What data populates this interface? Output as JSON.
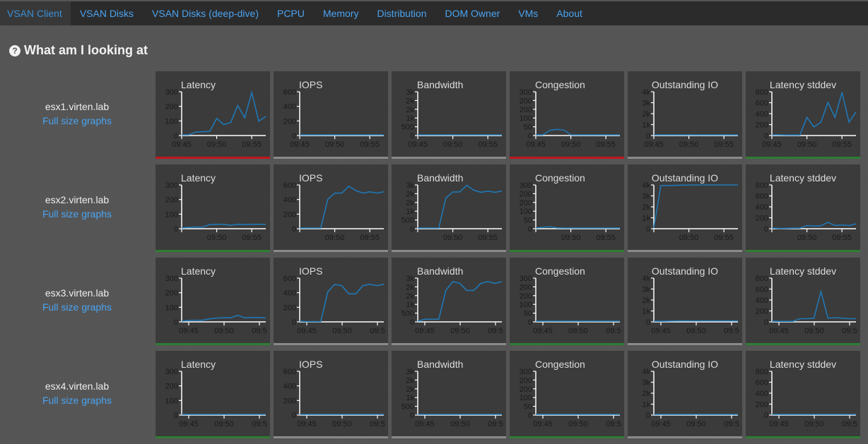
{
  "nav": {
    "items": [
      {
        "label": "VSAN Client",
        "active": true
      },
      {
        "label": "VSAN Disks"
      },
      {
        "label": "VSAN Disks (deep-dive)"
      },
      {
        "label": "PCPU"
      },
      {
        "label": "Memory"
      },
      {
        "label": "Distribution"
      },
      {
        "label": "DOM Owner"
      },
      {
        "label": "VMs"
      },
      {
        "label": "About"
      }
    ]
  },
  "help": {
    "label": "What am I looking at",
    "icon": "question-circle-icon"
  },
  "full_size_label": "Full size graphs",
  "colors": {
    "line": "#1f77b4",
    "red": "#c0161b",
    "gray": "#8a8a8a",
    "green": "#2e7d32"
  },
  "chart_data": [
    {
      "host": "esx1.virten.lab",
      "charts": [
        {
          "type": "line",
          "title": "Latency",
          "yticks": [
            "0",
            "100",
            "200",
            "300"
          ],
          "ylim": [
            0,
            320
          ],
          "xticks": [
            "09:45",
            "09:50",
            "09:55"
          ],
          "x": [
            0,
            1,
            2,
            3,
            4,
            5,
            6,
            7,
            8,
            9,
            10,
            11,
            12
          ],
          "values": [
            0,
            5,
            25,
            28,
            30,
            125,
            80,
            95,
            220,
            130,
            315,
            105,
            140
          ],
          "status": "red"
        },
        {
          "type": "line",
          "title": "IOPS",
          "yticks": [
            "0",
            "200",
            "400",
            "600"
          ],
          "ylim": [
            0,
            640
          ],
          "xticks": [
            "09:45",
            "09:50",
            "09:55"
          ],
          "x": [
            0,
            12
          ],
          "values": [
            0,
            0
          ],
          "status": "gray"
        },
        {
          "type": "line",
          "title": "Bandwidth",
          "yticks": [
            "0",
            "500",
            "1k",
            "2k",
            "2k",
            "3k"
          ],
          "ylim": [
            0,
            2500
          ],
          "xticks": [
            "09:45",
            "09:50",
            "09:55"
          ],
          "x": [
            0,
            12
          ],
          "values": [
            0,
            0
          ],
          "status": "gray"
        },
        {
          "type": "line",
          "title": "Congestion",
          "yticks": [
            "0",
            "50",
            "100",
            "200",
            "200",
            "300"
          ],
          "ylim": [
            0,
            250
          ],
          "xticks": [
            "09:45",
            "09:50",
            "09:55"
          ],
          "x": [
            0,
            1,
            2,
            3,
            4,
            5,
            6,
            12
          ],
          "values": [
            0,
            0,
            30,
            35,
            32,
            0,
            0,
            0
          ],
          "status": "red"
        },
        {
          "type": "line",
          "title": "Outstanding IO",
          "yticks": [
            "0",
            "1k",
            "2k",
            "3k",
            "4k"
          ],
          "ylim": [
            0,
            4000
          ],
          "xticks": [
            "09:45",
            "09:50",
            "09:55"
          ],
          "x": [
            0,
            12
          ],
          "values": [
            0,
            0
          ],
          "status": "gray"
        },
        {
          "type": "line",
          "title": "Latency stddev",
          "yticks": [
            "0",
            "200",
            "400",
            "600",
            "800"
          ],
          "ylim": [
            0,
            820
          ],
          "xticks": [
            "09:45",
            "09:50",
            "09:55"
          ],
          "x": [
            0,
            1,
            2,
            3,
            4,
            5,
            6,
            7,
            8,
            9,
            10,
            11,
            12
          ],
          "values": [
            0,
            0,
            10,
            10,
            10,
            340,
            160,
            250,
            620,
            340,
            810,
            250,
            440
          ],
          "status": "green"
        }
      ]
    },
    {
      "host": "esx2.virten.lab",
      "charts": [
        {
          "type": "line",
          "title": "Latency",
          "yticks": [
            "0",
            "100",
            "200",
            "300"
          ],
          "ylim": [
            0,
            320
          ],
          "xticks": [
            "09:50",
            "09:55"
          ],
          "x": [
            0,
            1,
            2,
            3,
            4,
            5,
            6,
            7,
            8,
            9,
            10,
            11,
            12
          ],
          "values": [
            0,
            10,
            12,
            12,
            30,
            32,
            32,
            25,
            32,
            30,
            32,
            32,
            32
          ],
          "status": "green"
        },
        {
          "type": "line",
          "title": "IOPS",
          "yticks": [
            "0",
            "200",
            "400",
            "600"
          ],
          "ylim": [
            0,
            640
          ],
          "xticks": [
            "09:50",
            "09:55"
          ],
          "x": [
            0,
            1,
            2,
            3,
            4,
            5,
            6,
            7,
            8,
            9,
            10,
            11,
            12
          ],
          "values": [
            0,
            0,
            0,
            0,
            430,
            520,
            520,
            620,
            560,
            520,
            540,
            520,
            540
          ],
          "status": "gray"
        },
        {
          "type": "line",
          "title": "Bandwidth",
          "yticks": [
            "0",
            "500",
            "1k",
            "2k",
            "2k",
            "3k"
          ],
          "ylim": [
            0,
            2500
          ],
          "xticks": [
            "09:50",
            "09:55"
          ],
          "x": [
            0,
            1,
            2,
            3,
            4,
            5,
            6,
            7,
            8,
            9,
            10,
            11,
            12
          ],
          "values": [
            0,
            0,
            0,
            0,
            1750,
            2100,
            2100,
            2480,
            2200,
            2080,
            2150,
            2080,
            2150
          ],
          "status": "gray"
        },
        {
          "type": "line",
          "title": "Congestion",
          "yticks": [
            "0",
            "50",
            "100",
            "200",
            "200",
            "300"
          ],
          "ylim": [
            0,
            250
          ],
          "xticks": [
            "09:50",
            "09:55"
          ],
          "x": [
            0,
            1,
            2,
            3,
            4,
            12
          ],
          "values": [
            0,
            8,
            12,
            5,
            0,
            0
          ],
          "status": "green"
        },
        {
          "type": "line",
          "title": "Outstanding IO",
          "yticks": [
            "0",
            "1k",
            "2k",
            "3k",
            "4k"
          ],
          "ylim": [
            0,
            4000
          ],
          "xticks": [
            "09:50",
            "09:55"
          ],
          "x": [
            0,
            1,
            2,
            4,
            6,
            12
          ],
          "values": [
            0,
            3950,
            3950,
            3980,
            4000,
            4000
          ],
          "status": "gray"
        },
        {
          "type": "line",
          "title": "Latency stddev",
          "yticks": [
            "0",
            "200",
            "400",
            "600",
            "800"
          ],
          "ylim": [
            0,
            820
          ],
          "xticks": [
            "09:50",
            "09:55"
          ],
          "x": [
            0,
            1,
            2,
            3,
            4,
            5,
            6,
            7,
            8,
            9,
            10,
            11,
            12
          ],
          "values": [
            0,
            5,
            8,
            10,
            10,
            60,
            50,
            55,
            120,
            60,
            70,
            60,
            90
          ],
          "status": "green"
        }
      ]
    },
    {
      "host": "esx3.virten.lab",
      "charts": [
        {
          "type": "line",
          "title": "Latency",
          "yticks": [
            "0",
            "100",
            "200",
            "300"
          ],
          "ylim": [
            0,
            320
          ],
          "xticks": [
            "09:45",
            "09:50",
            "09:5"
          ],
          "x": [
            0,
            1,
            2,
            3,
            4,
            5,
            6,
            7,
            8,
            9,
            10,
            11,
            12
          ],
          "values": [
            0,
            10,
            12,
            12,
            22,
            28,
            30,
            30,
            48,
            30,
            32,
            32,
            28
          ],
          "status": "green"
        },
        {
          "type": "line",
          "title": "IOPS",
          "yticks": [
            "0",
            "200",
            "400",
            "600"
          ],
          "ylim": [
            0,
            640
          ],
          "xticks": [
            "09:45",
            "09:50",
            "09:5"
          ],
          "x": [
            0,
            1,
            2,
            3,
            4,
            5,
            6,
            7,
            8,
            9,
            10,
            11,
            12
          ],
          "values": [
            0,
            5,
            5,
            5,
            440,
            550,
            530,
            410,
            410,
            530,
            550,
            530,
            550
          ],
          "status": "gray"
        },
        {
          "type": "line",
          "title": "Bandwidth",
          "yticks": [
            "0",
            "500",
            "1k",
            "2k",
            "2k",
            "3k"
          ],
          "ylim": [
            0,
            2500
          ],
          "xticks": [
            "09:45",
            "09:50",
            "09:5"
          ],
          "x": [
            0,
            1,
            2,
            3,
            4,
            5,
            6,
            7,
            8,
            9,
            10,
            11,
            12
          ],
          "values": [
            0,
            150,
            150,
            150,
            1800,
            2300,
            2200,
            1800,
            1800,
            2200,
            2300,
            2200,
            2300
          ],
          "status": "gray"
        },
        {
          "type": "line",
          "title": "Congestion",
          "yticks": [
            "0",
            "50",
            "100",
            "200",
            "200",
            "300"
          ],
          "ylim": [
            0,
            250
          ],
          "xticks": [
            "09:45",
            "09:50",
            "09:5"
          ],
          "x": [
            0,
            12
          ],
          "values": [
            0,
            0
          ],
          "status": "green"
        },
        {
          "type": "line",
          "title": "Outstanding IO",
          "yticks": [
            "0",
            "1k",
            "2k",
            "3k",
            "4k"
          ],
          "ylim": [
            0,
            4000
          ],
          "xticks": [
            "09:45",
            "09:50",
            "09:5"
          ],
          "x": [
            0,
            1,
            4,
            8,
            12
          ],
          "values": [
            0,
            60,
            100,
            100,
            100
          ],
          "status": "gray"
        },
        {
          "type": "line",
          "title": "Latency stddev",
          "yticks": [
            "0",
            "200",
            "400",
            "600",
            "800"
          ],
          "ylim": [
            0,
            820
          ],
          "xticks": [
            "09:45",
            "09:50",
            "09:5"
          ],
          "x": [
            0,
            1,
            2,
            3,
            4,
            5,
            6,
            7,
            8,
            9,
            10,
            11,
            12
          ],
          "values": [
            0,
            10,
            10,
            10,
            60,
            60,
            70,
            570,
            70,
            80,
            70,
            60,
            60
          ],
          "status": "green"
        }
      ]
    },
    {
      "host": "esx4.virten.lab",
      "charts": [
        {
          "type": "line",
          "title": "Latency",
          "yticks": [
            "0",
            "100",
            "200",
            "300"
          ],
          "ylim": [
            0,
            320
          ],
          "xticks": [
            "09:45",
            "09:50",
            "09:5"
          ],
          "x": [
            0,
            12
          ],
          "values": [
            0,
            0
          ],
          "status": "green"
        },
        {
          "type": "line",
          "title": "IOPS",
          "yticks": [
            "0",
            "200",
            "400",
            "600"
          ],
          "ylim": [
            0,
            640
          ],
          "xticks": [
            "09:45",
            "09:50",
            "09:5"
          ],
          "x": [
            0,
            12
          ],
          "values": [
            0,
            0
          ],
          "status": "gray"
        },
        {
          "type": "line",
          "title": "Bandwidth",
          "yticks": [
            "0",
            "500",
            "1k",
            "2k",
            "2k",
            "3k"
          ],
          "ylim": [
            0,
            2500
          ],
          "xticks": [
            "09:45",
            "09:50",
            "09:5"
          ],
          "x": [
            0,
            12
          ],
          "values": [
            0,
            0
          ],
          "status": "gray"
        },
        {
          "type": "line",
          "title": "Congestion",
          "yticks": [
            "0",
            "50",
            "100",
            "200",
            "200",
            "300"
          ],
          "ylim": [
            0,
            250
          ],
          "xticks": [
            "09:45",
            "09:50",
            "09:5"
          ],
          "x": [
            0,
            12
          ],
          "values": [
            0,
            0
          ],
          "status": "green"
        },
        {
          "type": "line",
          "title": "Outstanding IO",
          "yticks": [
            "0",
            "1k",
            "2k",
            "3k",
            "4k"
          ],
          "ylim": [
            0,
            4000
          ],
          "xticks": [
            "09:45",
            "09:50",
            "09:5"
          ],
          "x": [
            0,
            12
          ],
          "values": [
            0,
            0
          ],
          "status": "gray"
        },
        {
          "type": "line",
          "title": "Latency stddev",
          "yticks": [
            "0",
            "200",
            "400",
            "600",
            "800"
          ],
          "ylim": [
            0,
            820
          ],
          "xticks": [
            "09:45",
            "09:50",
            "09:5"
          ],
          "x": [
            0,
            12
          ],
          "values": [
            0,
            0
          ],
          "status": "green"
        }
      ]
    }
  ]
}
